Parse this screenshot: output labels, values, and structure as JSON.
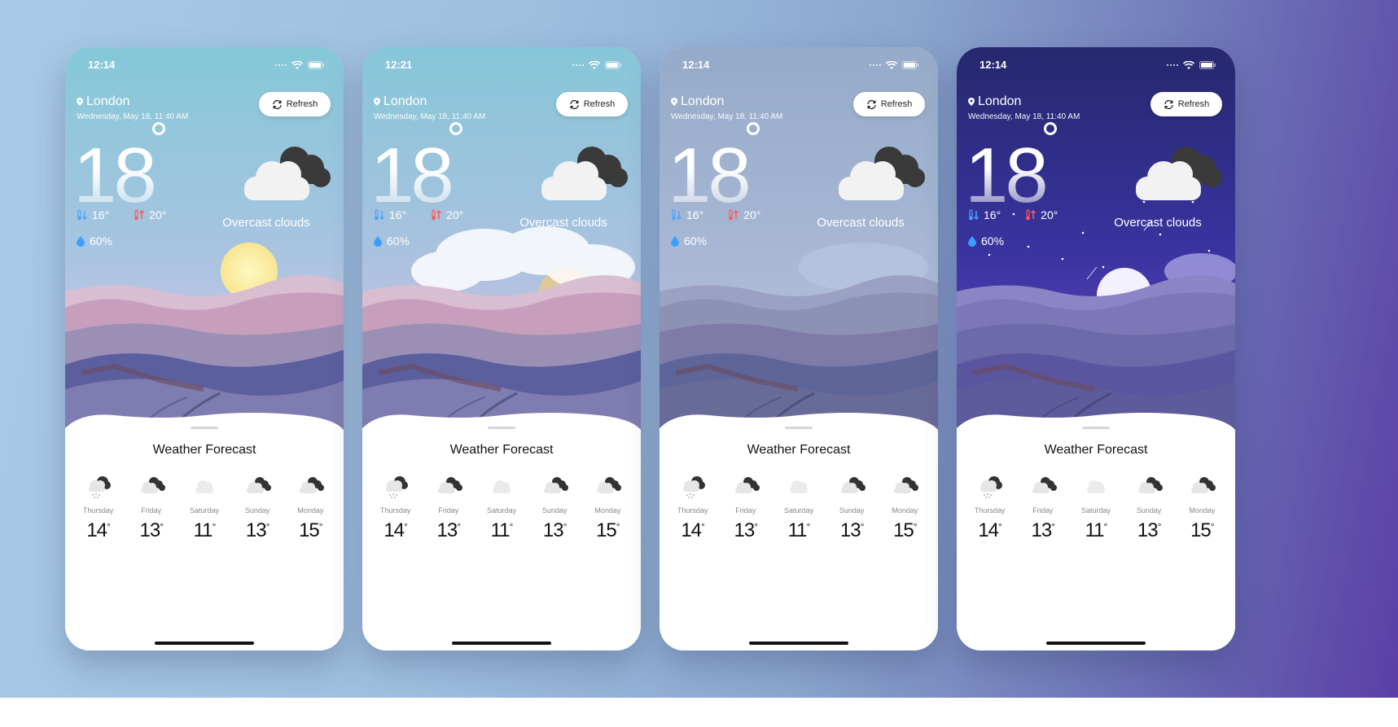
{
  "phones": [
    {
      "variant": "day",
      "status_time": "12:14",
      "city": "London",
      "date": "Wednesday, May 18, 11:40 AM",
      "refresh_label": "Refresh",
      "temperature": "18",
      "min_temp": "16°",
      "max_temp": "20°",
      "humidity": "60%",
      "condition": "Overcast clouds",
      "forecast_title": "Weather Forecast"
    },
    {
      "variant": "cloudy-sunset",
      "status_time": "12:21",
      "city": "London",
      "date": "Wednesday, May 18, 11:40 AM",
      "refresh_label": "Refresh",
      "temperature": "18",
      "min_temp": "16°",
      "max_temp": "20°",
      "humidity": "60%",
      "condition": "Overcast clouds",
      "forecast_title": "Weather Forecast"
    },
    {
      "variant": "overcast",
      "status_time": "12:14",
      "city": "London",
      "date": "Wednesday, May 18, 11:40 AM",
      "refresh_label": "Refresh",
      "temperature": "18",
      "min_temp": "16°",
      "max_temp": "20°",
      "humidity": "60%",
      "condition": "Overcast clouds",
      "forecast_title": "Weather Forecast"
    },
    {
      "variant": "night",
      "status_time": "12:14",
      "city": "London",
      "date": "Wednesday, May 18, 11:40 AM",
      "refresh_label": "Refresh",
      "temperature": "18",
      "min_temp": "16°",
      "max_temp": "20°",
      "humidity": "60%",
      "condition": "Overcast clouds",
      "forecast_title": "Weather Forecast"
    }
  ],
  "forecast": [
    {
      "day": "Thursday",
      "temp": "14",
      "icon": "rain-cloud-icon"
    },
    {
      "day": "Friday",
      "temp": "13",
      "icon": "broken-clouds-icon"
    },
    {
      "day": "Saturday",
      "temp": "11",
      "icon": "light-cloud-icon"
    },
    {
      "day": "Sunday",
      "temp": "13",
      "icon": "broken-clouds-icon"
    },
    {
      "day": "Monday",
      "temp": "15",
      "icon": "broken-clouds-icon"
    }
  ],
  "degree_symbol": "°",
  "colors": {
    "day_sky_top": "#86c9da",
    "day_sky_bottom": "#c4c9e3",
    "overcast_sky_top": "#8fa9c9",
    "night_sky_top": "#2b2c7a",
    "night_sky_bottom": "#4a3ab0",
    "min_temp_icon": "#4aa3ff",
    "max_temp_icon": "#ff5a5a",
    "humidity_icon": "#3aa0ff"
  }
}
